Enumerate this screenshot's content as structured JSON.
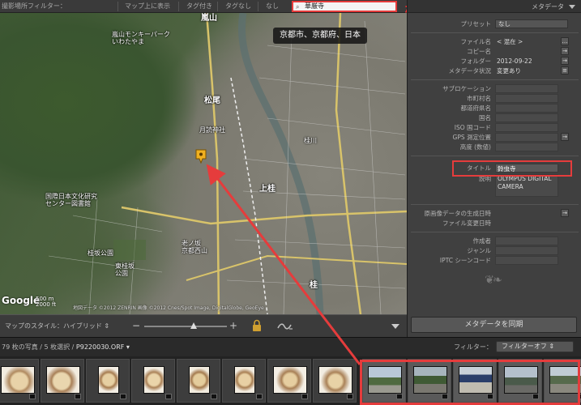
{
  "topbar": {
    "filter_label": "撮影場所フィルター：",
    "items": [
      "マップ上に表示",
      "タグ付き",
      "タグなし",
      "なし"
    ],
    "search_value": "華厳寺",
    "annotation": "検索"
  },
  "map": {
    "location_banner": "京都市、京都府、日本",
    "labels": {
      "arashiyama": "嵐山",
      "monkey_park": "嵐山モンキーパーク\nいわたやま",
      "matsuo": "松尾",
      "matsunoo_shrine": "月読神社",
      "kamikatsura": "上桂",
      "katsura": "桂",
      "kokusai": "国際日本文化研究\nセンター図書館",
      "katsurazaka": "桂坂公園",
      "oharano": "老ノ坂\n京都西山",
      "katsura_river": "桂川",
      "higashi_park": "東桂坂\n公園"
    },
    "google": "Google",
    "scale": "500 m\n2000 ft",
    "copyright": "地図データ ©2012 ZENRIN 画像 ©2012 Cnes/Spot Image, DigitalGlobe, GeoEye"
  },
  "map_toolbar": {
    "style_label": "マップのスタイル：",
    "style_value": "ハイブリッド ⇕",
    "zoom_out": "−",
    "zoom_in": "+",
    "zoom_level": 0.6
  },
  "panel": {
    "header": "メタデータ",
    "preset_label": "プリセット",
    "preset_value": "なし",
    "rows": [
      {
        "label": "ファイル名",
        "value": "< 混在 >"
      },
      {
        "label": "コピー名",
        "value": ""
      },
      {
        "label": "フォルダー",
        "value": "2012-09-22"
      },
      {
        "label": "メタデータ状況",
        "value": "変更あり"
      },
      {
        "label": "サブロケーション",
        "value": ""
      },
      {
        "label": "市町村名",
        "value": ""
      },
      {
        "label": "都道府県名",
        "value": ""
      },
      {
        "label": "国名",
        "value": ""
      },
      {
        "label": "ISO 国コード",
        "value": ""
      },
      {
        "label": "GPS 測定位置",
        "value": ""
      },
      {
        "label": "高度 (数値)",
        "value": ""
      },
      {
        "label": "タイトル",
        "value": "鈴虫寺"
      },
      {
        "label": "説明",
        "value": "OLYMPUS DIGITAL\nCAMERA"
      },
      {
        "label": "原画像データの生成日時",
        "value": ""
      },
      {
        "label": "ファイル変更日時",
        "value": ""
      },
      {
        "label": "作成者",
        "value": ""
      },
      {
        "label": "ジャンル",
        "value": ""
      },
      {
        "label": "IPTC シーンコード",
        "value": ""
      }
    ],
    "sync_button": "メタデータを同期"
  },
  "filmstrip": {
    "count": "79 枚の写真 / 5 枚選択 /",
    "file": "P9220030.ORF ▾",
    "filter_label": "フィルター：",
    "filter_value": "フィルターオフ ⇕"
  },
  "colors": {
    "highlight": "#e53c3c",
    "pin": "#f0b020"
  }
}
